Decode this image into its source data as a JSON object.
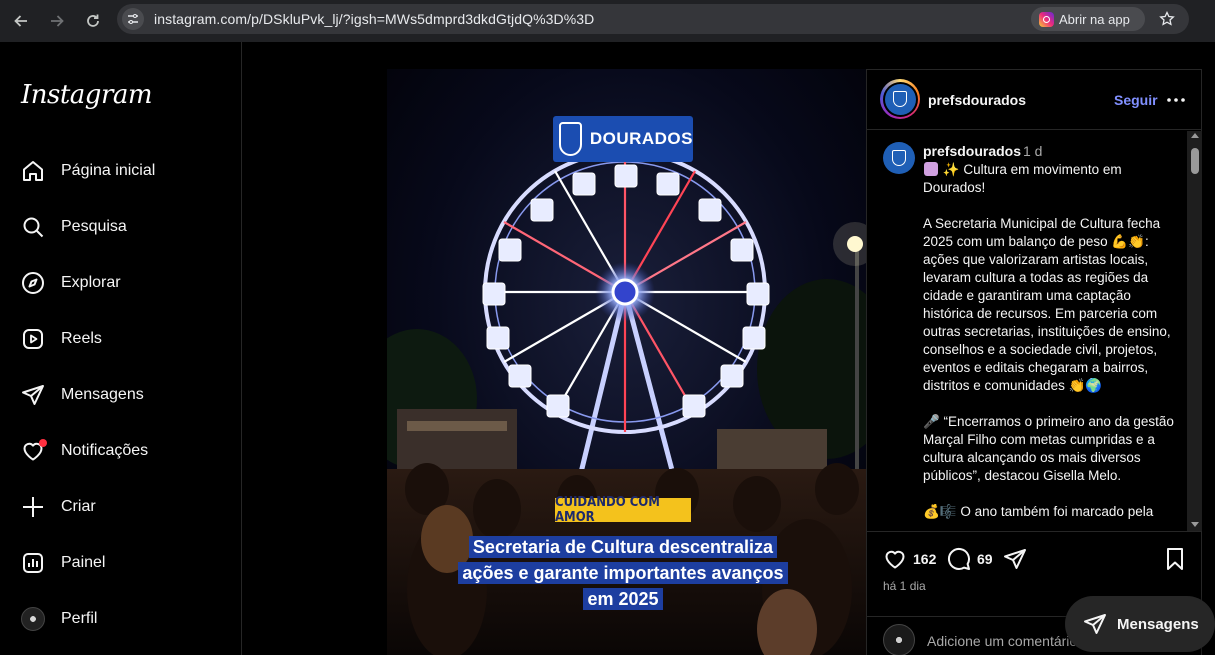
{
  "browser": {
    "url": "instagram.com/p/DSkluPvk_lj/?igsh=MWs5dmprd3dkdGtjdQ%3D%3D",
    "open_app_label": "Abrir na app",
    "icons": [
      "back-arrow-icon",
      "forward-arrow-icon",
      "reload-icon",
      "site-info-icon",
      "instagram-icon",
      "star-icon"
    ]
  },
  "sidebar": {
    "logo": "Instagram",
    "items": [
      {
        "label": "Página inicial",
        "icon": "home-icon"
      },
      {
        "label": "Pesquisa",
        "icon": "search-icon"
      },
      {
        "label": "Explorar",
        "icon": "compass-icon"
      },
      {
        "label": "Reels",
        "icon": "reels-icon"
      },
      {
        "label": "Mensagens",
        "icon": "messenger-icon"
      },
      {
        "label": "Notificações",
        "icon": "heart-icon"
      },
      {
        "label": "Criar",
        "icon": "plus-icon"
      },
      {
        "label": "Painel",
        "icon": "dashboard-icon"
      },
      {
        "label": "Perfil",
        "icon": "profile-avatar"
      }
    ]
  },
  "post_image": {
    "brand": "DOURADOS",
    "tag": "CUIDANDO COM AMOR",
    "headline": "Secretaria de Cultura descentraliza ações e garante importantes avanços em 2025"
  },
  "post": {
    "username": "prefsdourados",
    "follow_label": "Seguir",
    "time_short": "1 d",
    "caption": [
      "✨ Cultura em movimento em Dourados!",
      "A Secretaria Municipal de Cultura fecha 2025 com um balanço de peso 💪👏: ações que valorizaram artistas locais, levaram cultura a todas as regiões da cidade e garantiram uma captação histórica de recursos. Em parceria com outras secretarias, instituições de ensino, conselhos e a sociedade civil, projetos, eventos e editais chegaram a bairros, distritos e comunidades 👏🌍",
      "🎤 “Encerramos o primeiro ano da gestão Marçal Filho com metas cumpridas e a cultura alcançando os mais diversos públicos”, destacou Gisella Melo.",
      "💰🎼 O ano também foi marcado pela"
    ],
    "likes": "162",
    "comments": "69",
    "time_long": "há 1 dia",
    "comment_placeholder": "Adicione um comentário..."
  },
  "floating": {
    "messages_label": "Mensagens"
  },
  "colors": {
    "background": "#000000",
    "follow": "#8190ff",
    "notification_dot": "#ff3040",
    "headline_bg": "#1d3ea0",
    "tag_bg": "#f4c21c"
  }
}
